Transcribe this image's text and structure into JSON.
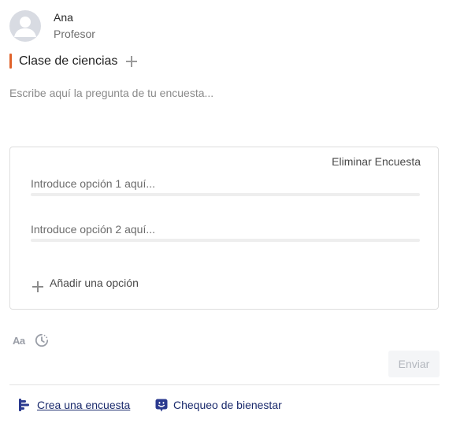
{
  "user": {
    "name": "Ana",
    "role": "Profesor",
    "avatar_icon": "user-silhouette-icon"
  },
  "class_selector": {
    "name": "Clase de ciencias",
    "accent_color": "#e0622a",
    "add_icon": "plus-icon"
  },
  "question": {
    "placeholder": "Escribe aquí la pregunta de tu encuesta...",
    "value": ""
  },
  "poll": {
    "delete_label": "Eliminar Encuesta",
    "options": [
      {
        "placeholder": "Introduce opción 1 aquí...",
        "value": ""
      },
      {
        "placeholder": "Introduce opción 2 aquí...",
        "value": ""
      }
    ],
    "add_option_label": "Añadir una opción"
  },
  "tools": {
    "format_label": "Aa",
    "schedule_icon": "clock-icon"
  },
  "send": {
    "label": "Enviar",
    "enabled": false
  },
  "bottom_actions": {
    "create_poll": {
      "label": "Crea una encuesta",
      "icon": "poll-bars-icon"
    },
    "wellbeing": {
      "label": "Chequeo de bienestar",
      "icon": "smile-face-icon"
    }
  },
  "colors": {
    "link": "#1a2a6c",
    "accent": "#e0622a",
    "muted_icon": "#9a9ea7"
  }
}
